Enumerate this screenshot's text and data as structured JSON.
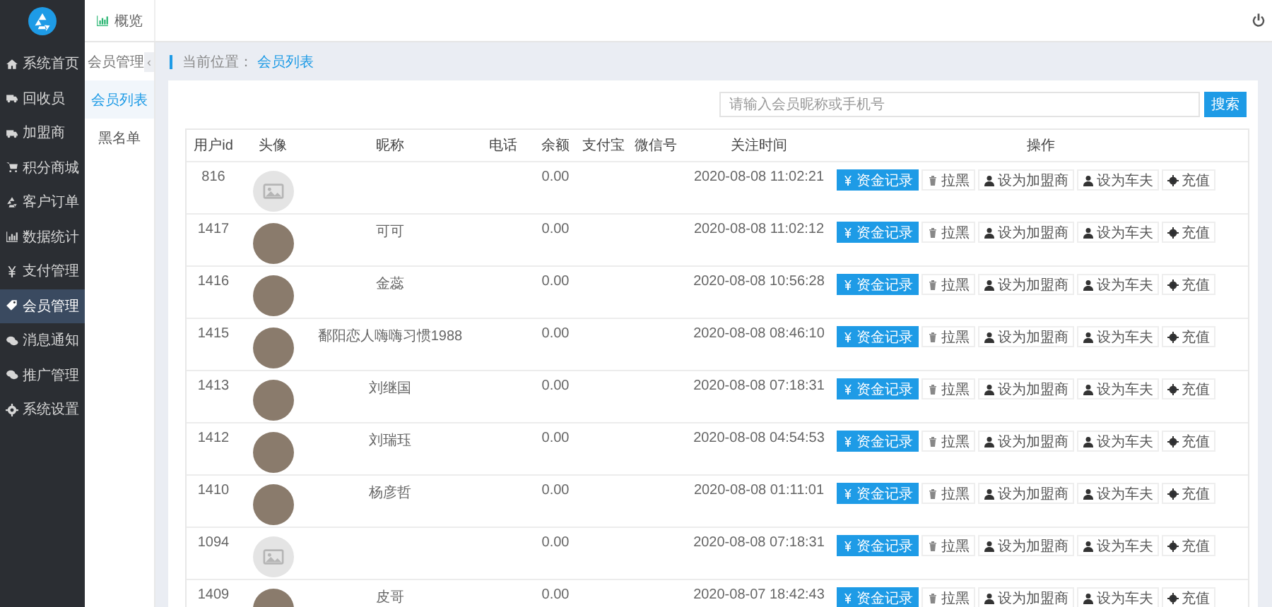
{
  "topbar": {
    "tab": "概览"
  },
  "sidebar": {
    "items": [
      {
        "label": "系统首页",
        "selected": false
      },
      {
        "label": "回收员",
        "selected": false
      },
      {
        "label": "加盟商",
        "selected": false
      },
      {
        "label": "积分商城",
        "selected": false
      },
      {
        "label": "客户订单",
        "selected": false
      },
      {
        "label": "数据统计",
        "selected": false
      },
      {
        "label": "支付管理",
        "selected": false
      },
      {
        "label": "会员管理",
        "selected": true
      },
      {
        "label": "消息通知",
        "selected": false
      },
      {
        "label": "推广管理",
        "selected": false
      },
      {
        "label": "系统设置",
        "selected": false
      }
    ]
  },
  "subnav": {
    "title": "会员管理",
    "collapse": "‹",
    "items": [
      {
        "label": "会员列表",
        "selected": true
      },
      {
        "label": "黑名单",
        "selected": false
      }
    ]
  },
  "breadcrumb": {
    "label": "当前位置：",
    "current": "会员列表"
  },
  "search": {
    "placeholder": "请输入会员昵称或手机号",
    "button": "搜索"
  },
  "table": {
    "columns": [
      "用户id",
      "头像",
      "昵称",
      "电话",
      "余额",
      "支付宝",
      "微信号",
      "关注时间",
      "操作"
    ],
    "rows": [
      {
        "id": "816",
        "avatar": {
          "kind": "placeholder"
        },
        "nickname": "",
        "balance": "0.00",
        "time": "2020-08-08 11:02:21",
        "actions": [
          "资金记录",
          "拉黑",
          "设为加盟商",
          "设为车夫",
          "充值"
        ]
      },
      {
        "id": "1417",
        "avatar": {
          "kind": "photo"
        },
        "nickname": "可可",
        "balance": "0.00",
        "time": "2020-08-08 11:02:12",
        "actions": [
          "资金记录",
          "拉黑",
          "设为加盟商",
          "设为车夫",
          "充值"
        ]
      },
      {
        "id": "1416",
        "avatar": {
          "kind": "photo"
        },
        "nickname": "金蕊",
        "balance": "0.00",
        "time": "2020-08-08 10:56:28",
        "actions": [
          "资金记录",
          "拉黑",
          "设为加盟商",
          "设为车夫",
          "充值"
        ]
      },
      {
        "id": "1415",
        "avatar": {
          "kind": "photo"
        },
        "nickname": "鄱阳恋人嗨嗨习惯1988",
        "balance": "0.00",
        "time": "2020-08-08 08:46:10",
        "actions": [
          "资金记录",
          "拉黑",
          "设为加盟商",
          "设为车夫",
          "充值"
        ]
      },
      {
        "id": "1413",
        "avatar": {
          "kind": "photo"
        },
        "nickname": "刘继国",
        "balance": "0.00",
        "time": "2020-08-08 07:18:31",
        "actions": [
          "资金记录",
          "拉黑",
          "设为加盟商",
          "设为车夫",
          "充值"
        ]
      },
      {
        "id": "1412",
        "avatar": {
          "kind": "photo"
        },
        "nickname": "刘瑞珏",
        "balance": "0.00",
        "time": "2020-08-08 04:54:53",
        "actions": [
          "资金记录",
          "拉黑",
          "设为加盟商",
          "设为车夫",
          "充值"
        ]
      },
      {
        "id": "1410",
        "avatar": {
          "kind": "photo"
        },
        "nickname": "杨彦哲",
        "balance": "0.00",
        "time": "2020-08-08 01:11:01",
        "actions": [
          "资金记录",
          "拉黑",
          "设为加盟商",
          "设为车夫",
          "充值"
        ]
      },
      {
        "id": "1094",
        "avatar": {
          "kind": "placeholder"
        },
        "nickname": "",
        "balance": "0.00",
        "time": "2020-08-08 07:18:31",
        "actions": [
          "资金记录",
          "拉黑",
          "设为加盟商",
          "设为车夫",
          "充值"
        ]
      },
      {
        "id": "1409",
        "avatar": {
          "kind": "photo"
        },
        "nickname": "皮哥",
        "balance": "0.00",
        "time": "2020-08-07 18:42:43",
        "actions": [
          "资金记录",
          "拉黑",
          "设为加盟商",
          "设为车夫",
          "充值"
        ]
      }
    ]
  }
}
